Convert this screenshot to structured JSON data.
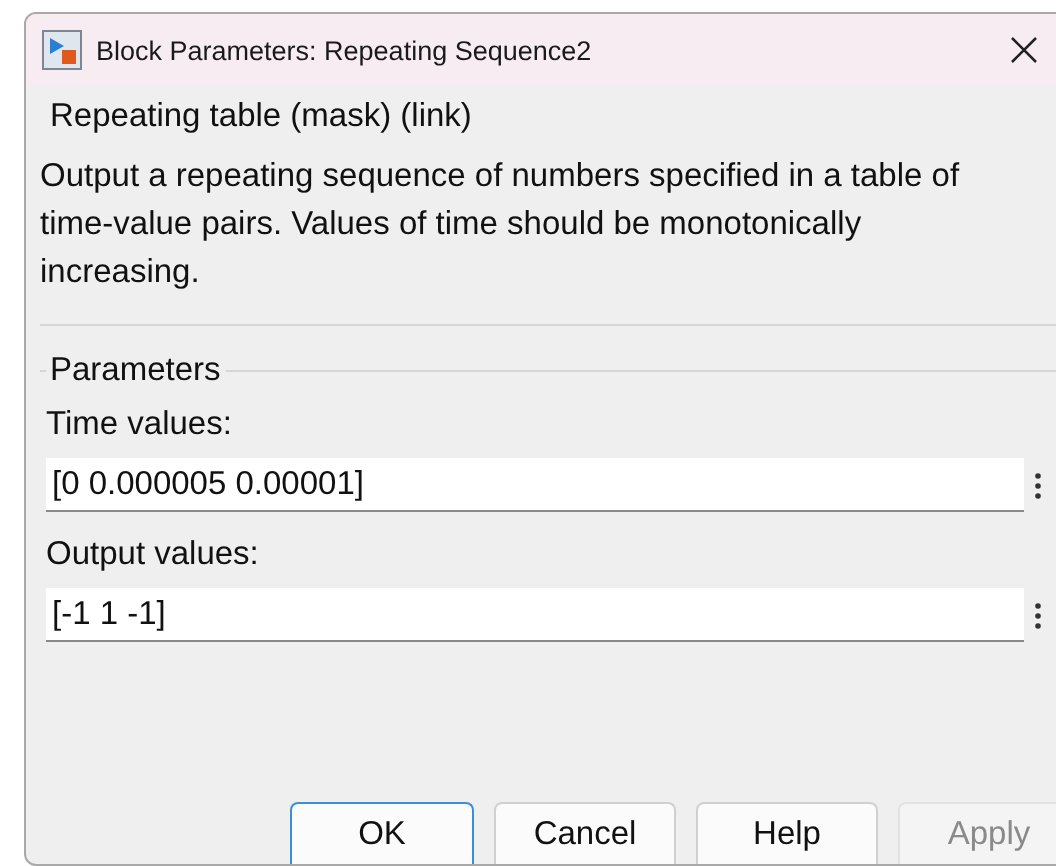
{
  "window": {
    "title": "Block Parameters: Repeating Sequence2"
  },
  "mask_group": {
    "title": "Repeating table (mask) (link)",
    "description": "Output a repeating sequence of numbers specified in a table of time-value pairs. Values of time should be monotonically increasing."
  },
  "parameters": {
    "title": "Parameters",
    "fields": [
      {
        "label": "Time values:",
        "value": "[0 0.000005 0.00001]"
      },
      {
        "label": "Output values:",
        "value": "[-1 1 -1]"
      }
    ]
  },
  "buttons": [
    {
      "label": "OK",
      "default": true,
      "disabled": false
    },
    {
      "label": "Cancel",
      "default": false,
      "disabled": false
    },
    {
      "label": "Help",
      "default": false,
      "disabled": false
    },
    {
      "label": "Apply",
      "default": false,
      "disabled": true
    }
  ]
}
